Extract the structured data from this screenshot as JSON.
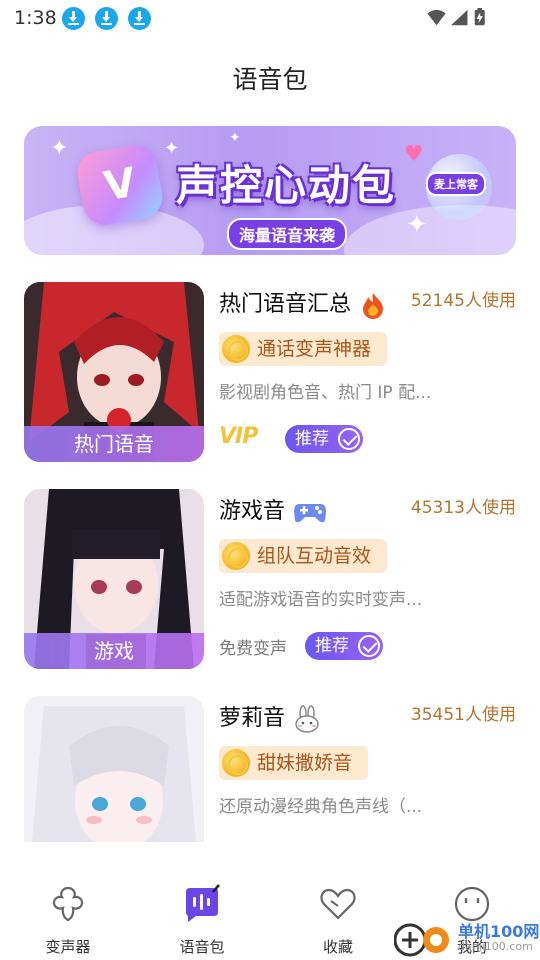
{
  "status_bar": {
    "time": "1:38",
    "notification_icons": [
      "download-icon",
      "download-icon",
      "download-icon"
    ],
    "system_icons": [
      "wifi-icon",
      "signal-icon",
      "battery-charging-icon"
    ]
  },
  "header": {
    "title": "语音包"
  },
  "banner": {
    "headline": "声控心动包",
    "subtitle": "海量语音来袭",
    "tag": "麦上常客",
    "logo_letter": "V"
  },
  "voice_packs": [
    {
      "name": "热门语音汇总",
      "emoji": "fire-icon",
      "users": "52145人使用",
      "thumb_caption": "热门语音",
      "feature": "通话变声神器",
      "description": "影视剧角色音、热门 IP 配...",
      "access": "VIP",
      "badge": "推荐"
    },
    {
      "name": "游戏音",
      "emoji": "gamepad-icon",
      "users": "45313人使用",
      "thumb_caption": "游戏",
      "feature": "组队互动音效",
      "description": "适配游戏语音的实时变声...",
      "access": "免费变声",
      "badge": "推荐"
    },
    {
      "name": "萝莉音",
      "emoji": "bunny-icon",
      "users": "35451人使用",
      "thumb_caption": "",
      "feature": "甜妹撒娇音",
      "description": "还原动漫经典角色声线（...",
      "access": "",
      "badge": ""
    }
  ],
  "bottom_nav": [
    {
      "label": "变声器",
      "icon": "voice-changer-icon",
      "active": false
    },
    {
      "label": "语音包",
      "icon": "voice-pack-icon",
      "active": true
    },
    {
      "label": "收藏",
      "icon": "heart-icon",
      "active": false
    },
    {
      "label": "我的",
      "icon": "profile-icon",
      "active": false
    }
  ],
  "watermark": {
    "text": "单机100网",
    "url": "danji100.com"
  },
  "colors": {
    "accent": "#7b5cf0",
    "user_count": "#b3742b",
    "chip_bg": "#fde9cf",
    "chip_text": "#a8551a"
  }
}
